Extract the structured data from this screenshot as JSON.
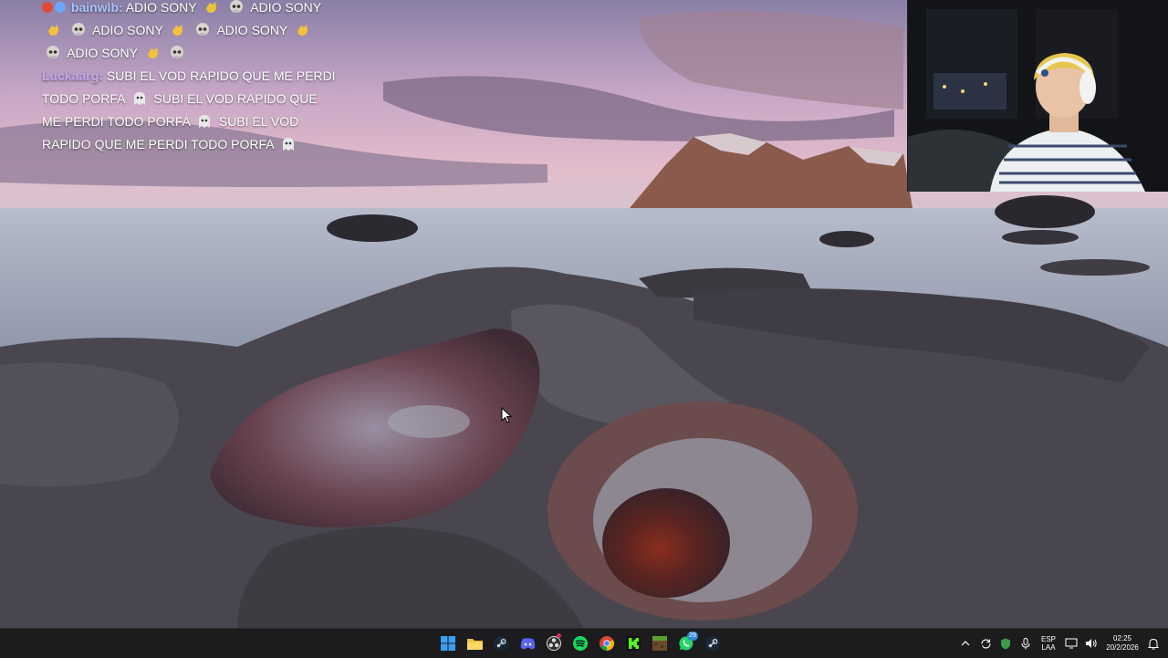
{
  "chat": {
    "messages": [
      {
        "user": "bainwlb",
        "text_parts": [
          "ADIO SONY",
          "ADIO SONY",
          "ADIO SONY",
          "ADIO SONY",
          "ADIO SONY"
        ],
        "user_color": "#a7c7ff"
      },
      {
        "user": "Luckaarg",
        "text_parts": [
          "SUBI EL VOD RAPIDO QUE ME PERDI",
          "TODO PORFA",
          "SUBI EL VOD RAPIDO QUE",
          "ME PERDI TODO PORFA",
          "SUBI EL VOD",
          "RAPIDO QUE ME PERDI TODO PORFA"
        ],
        "user_color": "#c4a8f0"
      }
    ],
    "line1_user": "bainwlb:",
    "line1_text": "ADIO SONY",
    "line1_text2": "ADIO SONY",
    "line2_text1": "ADIO SONY",
    "line2_text2": "ADIO SONY",
    "line3_text": "ADIO SONY",
    "line4_user": "Luckaarg:",
    "line4_text": "SUBI EL VOD RAPIDO QUE ME PERDI",
    "line5_text1": "TODO PORFA",
    "line5_text2": "SUBI EL VOD RAPIDO QUE",
    "line6_text1": "ME PERDI TODO PORFA",
    "line6_text2": "SUBI EL VOD",
    "line7_text": "RAPIDO QUE ME PERDI TODO PORFA"
  },
  "taskbar": {
    "apps": [
      {
        "name": "start",
        "icon": "windows-logo-icon"
      },
      {
        "name": "file-explorer",
        "icon": "folder-icon"
      },
      {
        "name": "steam",
        "icon": "steam-icon"
      },
      {
        "name": "discord",
        "icon": "discord-icon"
      },
      {
        "name": "obs",
        "icon": "obs-icon"
      },
      {
        "name": "spotify",
        "icon": "spotify-icon"
      },
      {
        "name": "chrome",
        "icon": "chrome-icon"
      },
      {
        "name": "kick",
        "icon": "kick-icon"
      },
      {
        "name": "minecraft",
        "icon": "minecraft-icon"
      },
      {
        "name": "whatsapp",
        "icon": "whatsapp-icon",
        "badge": "29"
      },
      {
        "name": "steam-2",
        "icon": "steam-icon"
      }
    ],
    "whatsapp_badge": "29",
    "language_top": "ESP",
    "language_bottom": "LAA",
    "time": "02:25",
    "date": "20/2/2026"
  },
  "colors": {
    "taskbar_bg": "#1c1c1e",
    "accent": "#2e8bd8",
    "chat_user1": "#a7c7ff",
    "chat_user2": "#c4a8f0"
  }
}
